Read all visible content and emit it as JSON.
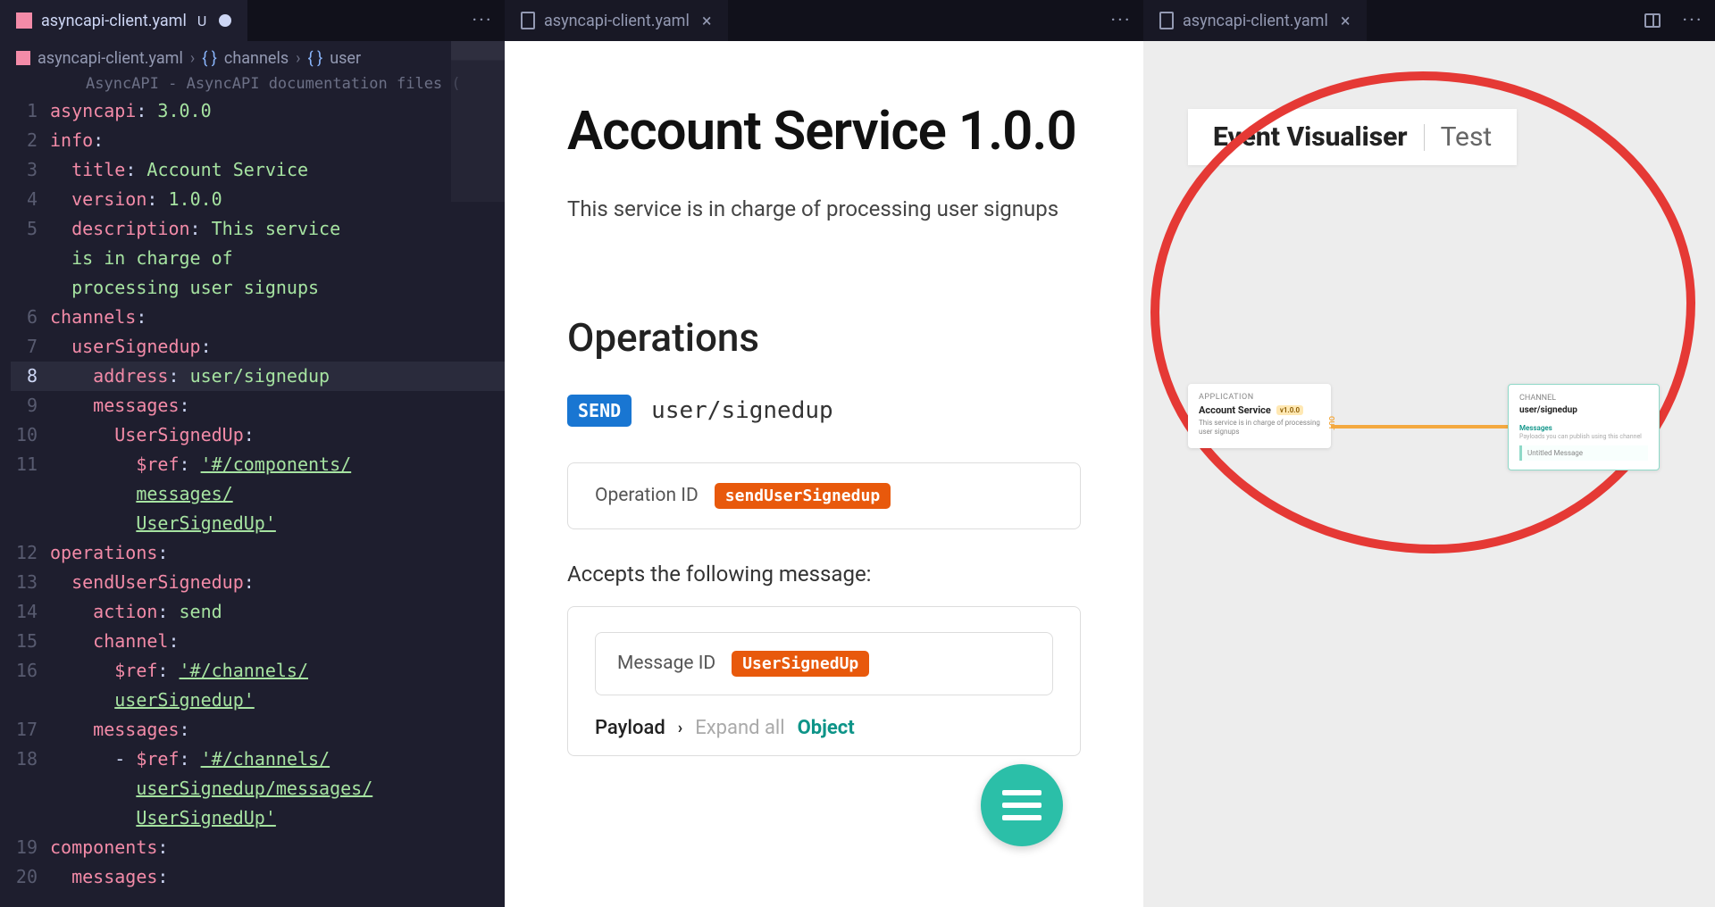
{
  "tabs": {
    "group1": {
      "file": "asyncapi-client.yaml",
      "modified": "U"
    },
    "group2": {
      "file": "asyncapi-client.yaml"
    },
    "group3": {
      "file": "asyncapi-client.yaml"
    }
  },
  "breadcrumb": {
    "file": "asyncapi-client.yaml",
    "seg1": "channels",
    "seg2": "user"
  },
  "hint": "AsyncAPI - AsyncAPI documentation files (",
  "code": {
    "l1a": "asyncapi",
    "l1b": "3.0.0",
    "l2a": "info",
    "l3a": "title",
    "l3b": "Account Service",
    "l4a": "version",
    "l4b": "1.0.0",
    "l5a": "description",
    "l5b": "This service ",
    "l5c": "is in charge of ",
    "l5d": "processing user signups",
    "l6a": "channels",
    "l7a": "userSignedup",
    "l8a": "address",
    "l8b": "user/signedup",
    "l9a": "messages",
    "l10a": "UserSignedUp",
    "l11a": "$ref",
    "l11b": "'#/components/",
    "l11c": "messages/",
    "l11d": "UserSignedUp'",
    "l12a": "operations",
    "l13a": "sendUserSignedup",
    "l14a": "action",
    "l14b": "send",
    "l15a": "channel",
    "l16a": "$ref",
    "l16b": "'#/channels/",
    "l16c": "userSignedup'",
    "l17a": "messages",
    "l18a": "$ref",
    "l18b": "'#/channels/",
    "l18c": "userSignedup/messages/",
    "l18d": "UserSignedUp'",
    "l19a": "components",
    "l20a": "messages"
  },
  "preview": {
    "title": "Account Service 1.0.0",
    "description": "This service is in charge of processing user signups",
    "operations_heading": "Operations",
    "badge_send": "SEND",
    "op_address": "user/signedup",
    "op_id_label": "Operation ID",
    "op_id_value": "sendUserSignedup",
    "accepts": "Accepts the following message:",
    "msg_id_label": "Message ID",
    "msg_id_value": "UserSignedUp",
    "payload_label": "Payload",
    "expand_all": "Expand all",
    "object": "Object"
  },
  "visualizer": {
    "title": "Event Visualiser",
    "subtitle": "Test",
    "app_label": "APPLICATION",
    "app_name": "Account Service",
    "app_version": "v1.0.0",
    "app_desc": "This service is in charge of processing user signups",
    "out_label": "OUT",
    "ch_label": "CHANNEL",
    "ch_name": "user/signedup",
    "ch_section": "Messages",
    "ch_sub": "Payloads you can publish using this channel",
    "ch_msg": "Untitled Message"
  }
}
